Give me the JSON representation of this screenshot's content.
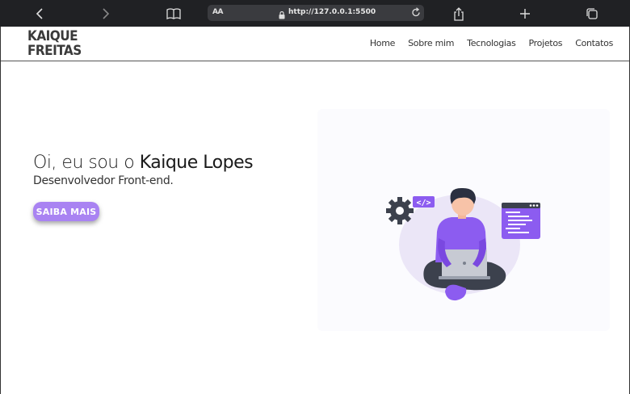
{
  "browser": {
    "aa_label": "AA",
    "url": "http://127.0.0.1:5500"
  },
  "header": {
    "logo_line1": "KAIQUE",
    "logo_line2": "FREITAS",
    "nav": [
      "Home",
      "Sobre mim",
      "Tecnologias",
      "Projetos",
      "Contatos"
    ]
  },
  "hero": {
    "title_prefix": "Oi, eu sou o ",
    "title_name": "Kaique Lopes",
    "subtitle": "Desenvolvedor Front-end.",
    "button_label": "SAIBA MAIS"
  },
  "colors": {
    "accent": "#a983f2",
    "illustration_purple": "#8c5cf0",
    "dark": "#3a3f4b"
  },
  "illustration": {
    "code_tag": "</>"
  }
}
